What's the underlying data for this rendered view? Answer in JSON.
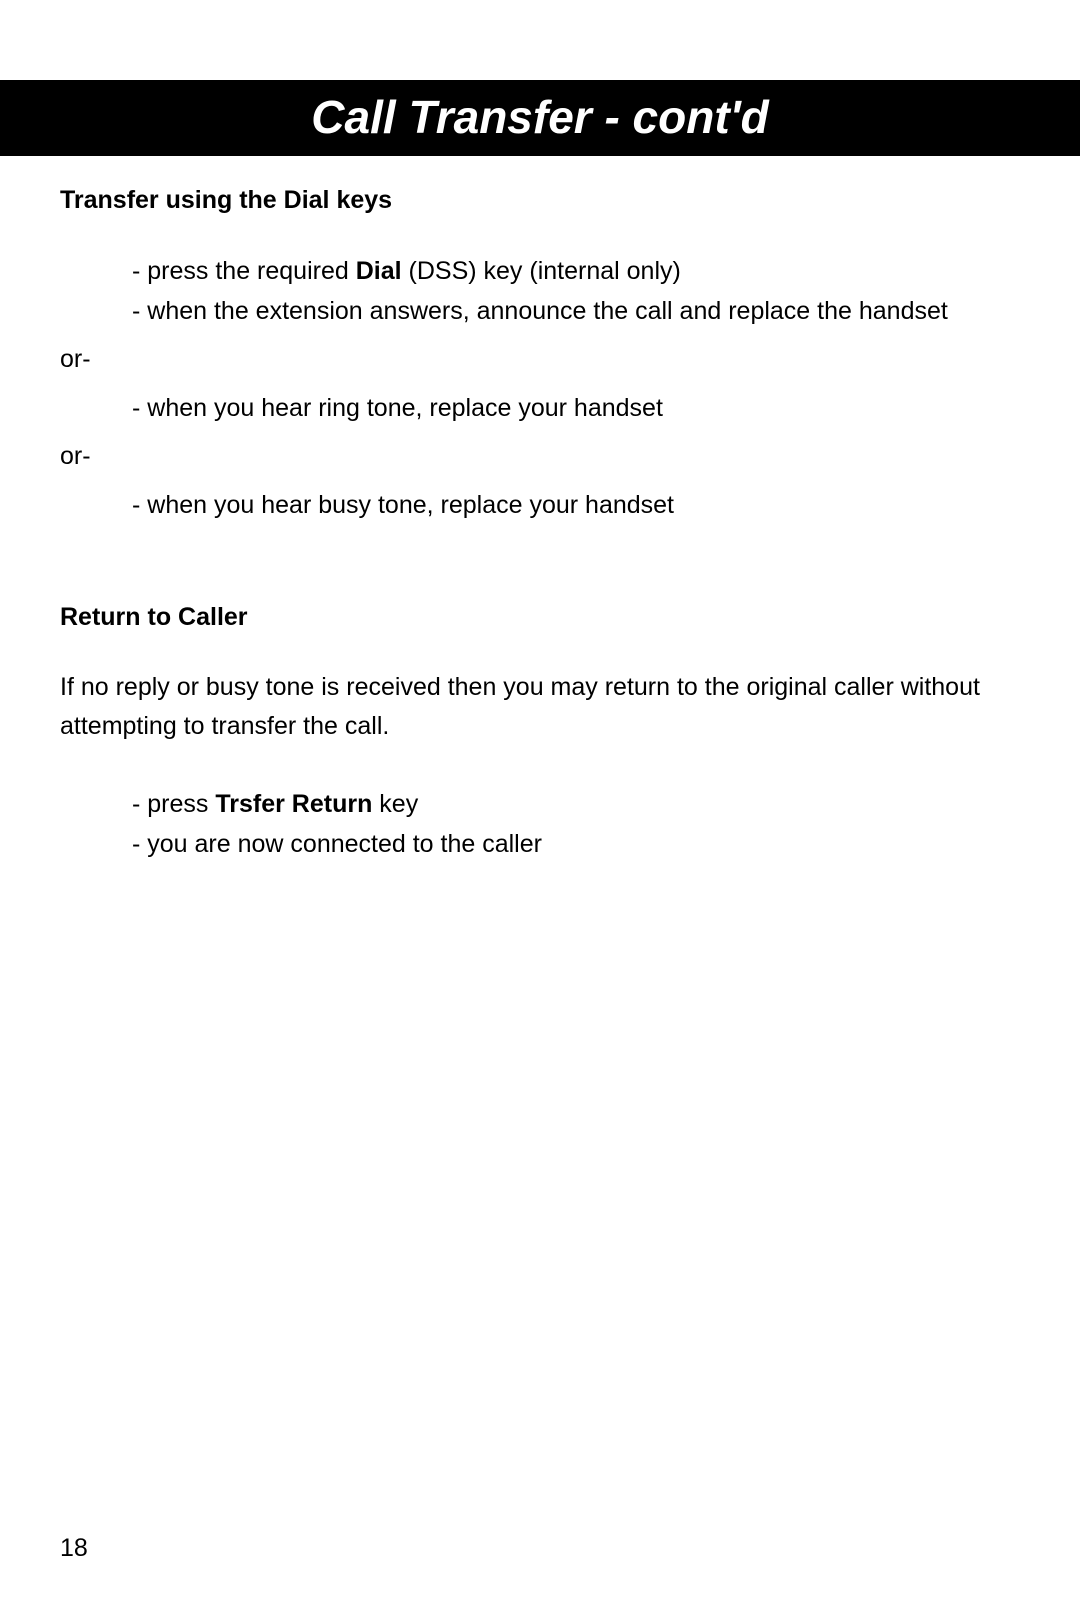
{
  "header": {
    "title": "Call Transfer  -  cont'd"
  },
  "section1": {
    "heading": "Transfer using the Dial keys",
    "items": {
      "i0_pre": "- press the required ",
      "i0_bold": "Dial",
      "i0_post": " (DSS) key (internal only)",
      "i1": "- when the extension answers, announce the call and replace the handset",
      "or1": "or-",
      "i2": "-  when you hear ring tone, replace your handset",
      "or2": "or-",
      "i3": "- when you hear busy tone, replace your handset"
    }
  },
  "section2": {
    "heading": "Return to Caller",
    "para": "If no reply or busy tone is received then you may return to the original caller without attempting to transfer the call.",
    "items": {
      "i0_pre": "- press ",
      "i0_bold": "Trsfer Return",
      "i0_post": " key",
      "i1": "- you are now connected to the caller"
    }
  },
  "footer": {
    "page_number": "18"
  }
}
